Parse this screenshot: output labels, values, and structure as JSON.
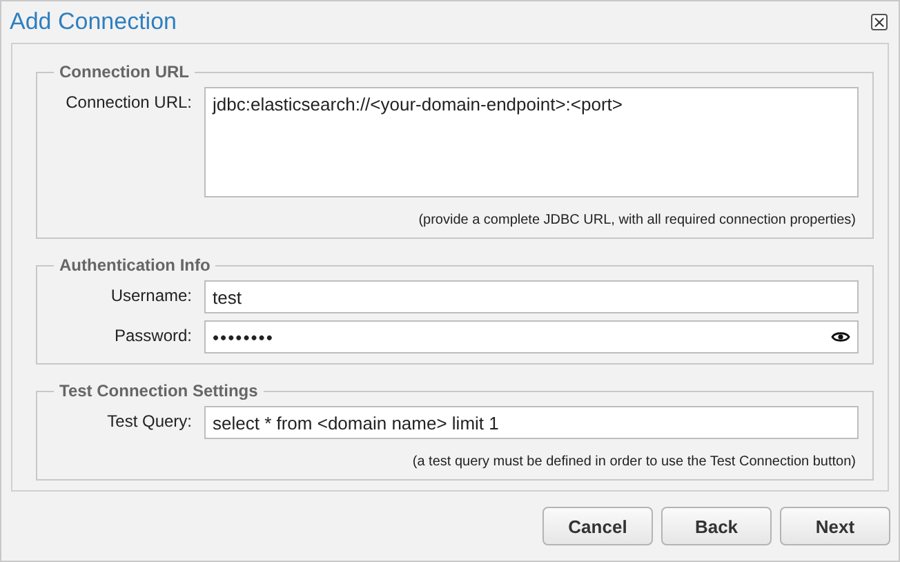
{
  "window": {
    "title": "Add Connection",
    "close": "×"
  },
  "sections": [
    {
      "legend": "Connection URL",
      "fields": [
        {
          "kind": "textarea",
          "label": "Connection URL:",
          "value": "jdbc:elasticsearch://<your-domain-endpoint>:<port>"
        }
      ],
      "hint": "(provide a complete JDBC URL, with all required connection properties)"
    },
    {
      "legend": "Authentication Info",
      "fields": [
        {
          "kind": "text",
          "label": "Username:",
          "value": "test"
        },
        {
          "kind": "password",
          "label": "Password:",
          "value": "••••••••"
        }
      ]
    },
    {
      "legend": "Test Connection Settings",
      "fields": [
        {
          "kind": "text",
          "label": "Test Query:",
          "value": "select * from <domain name> limit 1"
        }
      ],
      "hint": "(a test query must be defined in order to use the Test Connection button)"
    }
  ],
  "buttons": [
    "Cancel",
    "Back",
    "Next"
  ]
}
